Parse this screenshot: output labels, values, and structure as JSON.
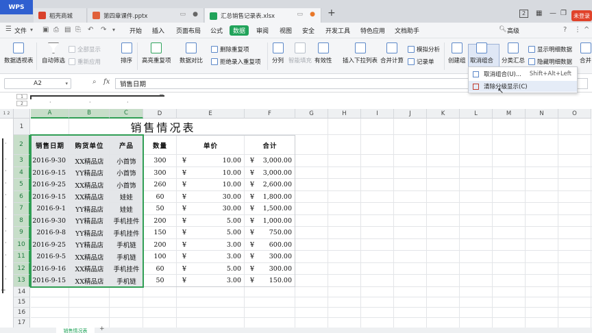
{
  "titlebar": {
    "wps": "WPS",
    "tabs": [
      {
        "label": "稻壳商城",
        "icon_color": "#d9412b"
      },
      {
        "label": "第四章课件.pptx",
        "icon_color": "#e0603a"
      },
      {
        "label": "汇总销售记录表.xlsx",
        "icon_color": "#21a35a"
      }
    ],
    "new_tab": "+",
    "badge": "2",
    "login": "未登录",
    "icons": [
      "monitor-icon",
      "dot-icon",
      "grid-icon",
      "minimize-icon",
      "restore-icon",
      "close-icon"
    ]
  },
  "menubar": {
    "file": "文件",
    "items": [
      "开始",
      "插入",
      "页面布局",
      "公式",
      "数据",
      "审阅",
      "视图",
      "安全",
      "开发工具",
      "特色应用",
      "文档助手"
    ],
    "active": "数据",
    "search": "高级"
  },
  "ribbon": {
    "pivot": "数据透视表",
    "autofilter": "自动筛选",
    "show_all": "全部显示",
    "reapply": "重新应用",
    "sort": "排序",
    "highlight_dup": "高亮重复项",
    "data_compare": "数据对比",
    "remove_dup": "删除重复项",
    "reject_dup": "拒绝录入重复项",
    "split": "分列",
    "smart_fill": "智能填充",
    "validity": "有效性",
    "insert_dropdown": "插入下拉列表",
    "merge_calc": "合并计算",
    "simulate": "模拟分析",
    "record": "记录单",
    "create_group": "创建组",
    "ungroup": "取消组合",
    "subtotal": "分类汇总",
    "show_detail": "显示明细数据",
    "hide_detail": "隐藏明细数据",
    "merge_cut": "合并"
  },
  "dropdown": {
    "items": [
      {
        "label": "取消组合(U)...",
        "shortcut": "Shift+Alt+Left"
      },
      {
        "label": "清除分级显示(C)",
        "shortcut": ""
      }
    ]
  },
  "formulabar": {
    "namebox": "A2",
    "fx": "fx",
    "content": "销售日期"
  },
  "outline": {
    "levels": [
      "1",
      "2"
    ]
  },
  "grid": {
    "columns": [
      "A",
      "B",
      "C",
      "D",
      "E",
      "F",
      "G",
      "H",
      "I",
      "J",
      "K",
      "L",
      "M",
      "N",
      "O"
    ],
    "rows": [
      "1",
      "2",
      "3",
      "4",
      "5",
      "6",
      "7",
      "8",
      "9",
      "10",
      "11",
      "12",
      "13",
      "14",
      "15",
      "16",
      "17"
    ],
    "title": "销售情况表",
    "headers": [
      "销售日期",
      "购货单位",
      "产品",
      "数量",
      "单价",
      "合计"
    ],
    "data": [
      [
        "2016-9-30",
        "XX精品店",
        "小首饰",
        "300",
        "¥",
        "10.00",
        "¥",
        "3,000.00"
      ],
      [
        "2016-9-15",
        "YY精品店",
        "小首饰",
        "300",
        "¥",
        "10.00",
        "¥",
        "3,000.00"
      ],
      [
        "2016-9-25",
        "XX精品店",
        "小首饰",
        "260",
        "¥",
        "10.00",
        "¥",
        "2,600.00"
      ],
      [
        "2016-9-15",
        "XX精品店",
        "娃娃",
        "60",
        "¥",
        "30.00",
        "¥",
        "1,800.00"
      ],
      [
        "2016-9-1",
        "YY精品店",
        "娃娃",
        "50",
        "¥",
        "30.00",
        "¥",
        "1,500.00"
      ],
      [
        "2016-9-30",
        "YY精品店",
        "手机挂件",
        "200",
        "¥",
        "5.00",
        "¥",
        "1,000.00"
      ],
      [
        "2016-9-8",
        "YY精品店",
        "手机挂件",
        "150",
        "¥",
        "5.00",
        "¥",
        "750.00"
      ],
      [
        "2016-9-25",
        "YY精品店",
        "手机链",
        "200",
        "¥",
        "3.00",
        "¥",
        "600.00"
      ],
      [
        "2016-9-5",
        "XX精品店",
        "手机链",
        "100",
        "¥",
        "3.00",
        "¥",
        "300.00"
      ],
      [
        "2016-9-16",
        "XX精品店",
        "手机挂件",
        "60",
        "¥",
        "5.00",
        "¥",
        "300.00"
      ],
      [
        "2016-9-15",
        "XX精品店",
        "手机链",
        "50",
        "¥",
        "3.00",
        "¥",
        "150.00"
      ]
    ]
  },
  "sheet": {
    "tab": "销售情况表",
    "add": "+"
  }
}
